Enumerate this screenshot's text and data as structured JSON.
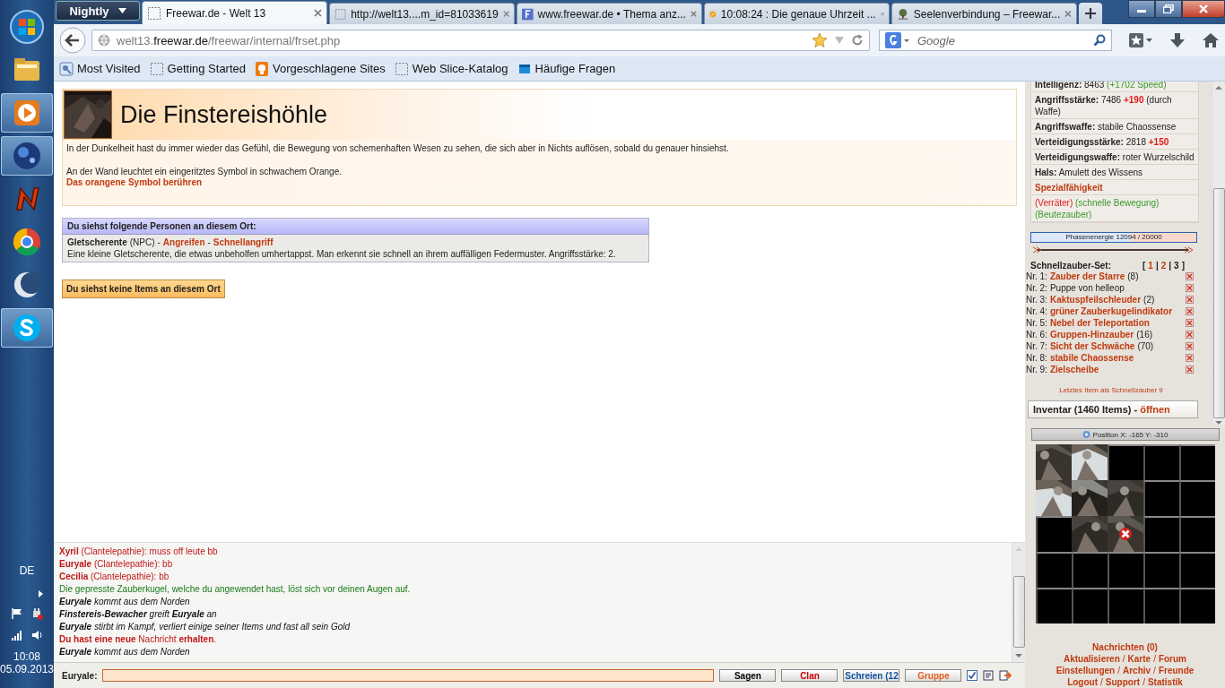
{
  "taskbar": {
    "apps": [
      {
        "kind": "start",
        "selected": false
      },
      {
        "kind": "folder",
        "selected": false
      },
      {
        "kind": "player",
        "selected": true
      },
      {
        "kind": "globe",
        "selected": true
      },
      {
        "kind": "letter",
        "selected": false
      },
      {
        "kind": "chrome",
        "selected": false
      },
      {
        "kind": "moon",
        "selected": false
      },
      {
        "kind": "skype",
        "selected": true
      }
    ],
    "language": "DE",
    "time": "10:08",
    "date": "05.09.2013"
  },
  "browser": {
    "menu_button": "Nightly",
    "tabs": [
      {
        "title": "Freewar.de - Welt 13",
        "selected": true
      },
      {
        "title": "http://welt13....m_id=81033619",
        "selected": false
      },
      {
        "title": "www.freewar.de • Thema anz...",
        "selected": false
      },
      {
        "title": "10:08:24 : Die genaue Uhrzeit ...",
        "selected": false
      },
      {
        "title": "Seelenverbindung – Freewar...",
        "selected": false
      }
    ],
    "url": "welt13.**freewar.de**/freewar/internal/frset.php",
    "search_placeholder": "Google",
    "bookmarks": [
      "Most Visited",
      "Getting Started",
      "Vorgeschlagene Sites",
      "Web Slice-Katalog",
      "Häufige Fragen"
    ]
  },
  "location": {
    "title": "Die Finstereishöhle",
    "description": "In der Dunkelheit hast du immer wieder das Gefühl, die Bewegung von schemenhaften Wesen zu sehen, die sich aber in Nichts auflösen, sobald du genauer hinsiehst.",
    "note": "An der Wand leuchtet ein eingeritztes Symbol in schwachem Orange.",
    "action": "Das orangene Symbol berühren"
  },
  "persons": {
    "header": "Du siehst folgende Personen an diesem Ort:",
    "entries": [
      {
        "name": "Gletscherente",
        "tag": "(NPC)",
        "separators": [
          "-",
          "-"
        ],
        "actions": [
          "Angreifen",
          "Schnellangriff"
        ],
        "description": "Eine kleine Gletscherente, die etwas unbeholfen umhertappst. Man erkennt sie schnell an ihrem auffälligen Federmuster. Angriffsstärke: 2."
      }
    ]
  },
  "items_notice": "Du siehst keine Items an diesem Ort",
  "chat": {
    "messages": [
      {
        "kind": "whisper",
        "text": "**Xyril** (Clantelepathie): muss off leute bb"
      },
      {
        "kind": "whisper",
        "text": "**Euryale** (Clantelepathie): bb"
      },
      {
        "kind": "whisper",
        "text": "**Cecilia** (Clantelepathie): bb"
      },
      {
        "kind": "system",
        "text": "Die gepresste Zauberkugel, welche du angewendet hast, löst sich vor deinen Augen auf."
      },
      {
        "kind": "event",
        "text": "**Euryale** kommt aus dem Norden"
      },
      {
        "kind": "event",
        "text": "**Finstereis-Bewacher** greift **Euryale** an"
      },
      {
        "kind": "event",
        "text": "**Euryale** stirbt im Kampf, verliert einige seiner Items und fast all sein Gold"
      },
      {
        "kind": "alert",
        "text": "**Du hast eine neue** Nachricht **erhalten**."
      },
      {
        "kind": "event",
        "text": "**Euryale** kommt aus dem Norden"
      }
    ],
    "input_label": "Euryale:",
    "buttons": [
      {
        "label": "Sagen",
        "color": "#000000"
      },
      {
        "label": "Clan",
        "color": "#cc0000"
      },
      {
        "label": "Schreien (12",
        "color": "#1050a0"
      },
      {
        "label": "Gruppe",
        "color": "#e06020"
      }
    ],
    "checkbox_checked": true
  },
  "stats": {
    "lines": [
      {
        "parts": [
          {
            "text": "Intelligenz:",
            "kind": "label"
          },
          {
            "text": "8463",
            "kind": "value"
          },
          {
            "text": "(+1702 Speed)",
            "kind": "bonus"
          }
        ]
      },
      {
        "parts": [
          {
            "text": "Angriffsstärke:",
            "kind": "label"
          },
          {
            "text": "7486",
            "kind": "value"
          },
          {
            "text": "+190",
            "kind": "boost"
          },
          {
            "text": "(durch Waffe)",
            "kind": "value"
          }
        ]
      },
      {
        "parts": [
          {
            "text": "Angriffswaffe:",
            "kind": "label"
          },
          {
            "text": "stabile Chaossense",
            "kind": "value"
          }
        ]
      },
      {
        "parts": [
          {
            "text": "Verteidigungsstärke:",
            "kind": "label"
          },
          {
            "text": "2818",
            "kind": "value"
          },
          {
            "text": "+150",
            "kind": "boost"
          }
        ]
      },
      {
        "parts": [
          {
            "text": "Verteidigungswaffe:",
            "kind": "label"
          },
          {
            "text": "roter Wurzelschild",
            "kind": "value"
          }
        ]
      },
      {
        "parts": [
          {
            "text": "Hals:",
            "kind": "label"
          },
          {
            "text": "Amulett des Wissens",
            "kind": "value"
          }
        ]
      },
      {
        "parts": [
          {
            "text": "Spezialfähigkeit",
            "kind": "heading"
          }
        ]
      },
      {
        "parts": [
          {
            "text": "(Verräter)",
            "kind": "malus"
          },
          {
            "text": "(schnelle Bewegung)",
            "kind": "bonus"
          },
          {
            "text": "(Beutezauber)",
            "kind": "bonus"
          }
        ]
      }
    ]
  },
  "phase_energy": {
    "reading": "Phasenenergie 12094 / 20000",
    "level": 0.6047
  },
  "quick_spells": {
    "label": "Schnellzauber-Set:",
    "open_bracket": "[",
    "close_bracket": "]",
    "separators": [
      "|",
      "|"
    ],
    "sets": [
      {
        "label": "1",
        "selected": false
      },
      {
        "label": "2",
        "selected": false
      },
      {
        "label": "3",
        "selected": true
      }
    ],
    "spells": [
      {
        "number": "Nr. 1:",
        "name": "Zauber der Starre",
        "count": "(8)",
        "link": true
      },
      {
        "number": "Nr. 2:",
        "name": "Puppe von helleop",
        "link": false
      },
      {
        "number": "Nr. 3:",
        "name": "Kaktuspfeilschleuder",
        "count": "(2)",
        "link": true
      },
      {
        "number": "Nr. 4:",
        "name": "grüner Zauberkugelindikator",
        "link": true
      },
      {
        "number": "Nr. 5:",
        "name": "Nebel der Teleportation",
        "link": true
      },
      {
        "number": "Nr. 6:",
        "name": "Gruppen-Hinzauber",
        "count": "(16)",
        "link": true
      },
      {
        "number": "Nr. 7:",
        "name": "Sicht der Schwäche",
        "count": "(70)",
        "link": true
      },
      {
        "number": "Nr. 8:",
        "name": "stabile Chaossense",
        "link": true
      },
      {
        "number": "Nr. 9:",
        "name": "Zielscheibe",
        "link": true
      }
    ],
    "last_item": "Letztes Item als Schnellzauber 9"
  },
  "inventory": {
    "label": "Inventar (1460 Items) -",
    "action": "öffnen"
  },
  "map": {
    "position": "Position X: -165 Y: -310",
    "tiles": [
      {
        "kind": "picture",
        "current": false
      },
      {
        "kind": "picture",
        "current": false
      },
      {
        "kind": "empty",
        "current": false
      },
      {
        "kind": "empty",
        "current": false
      },
      {
        "kind": "empty",
        "current": false
      },
      {
        "kind": "picture",
        "current": false
      },
      {
        "kind": "picture",
        "current": false
      },
      {
        "kind": "picture",
        "current": false
      },
      {
        "kind": "empty",
        "current": false
      },
      {
        "kind": "empty",
        "current": false
      },
      {
        "kind": "empty",
        "current": false
      },
      {
        "kind": "picture",
        "current": false
      },
      {
        "kind": "picture",
        "current": true
      },
      {
        "kind": "empty",
        "current": false
      },
      {
        "kind": "empty",
        "current": false
      },
      {
        "kind": "empty",
        "current": false
      },
      {
        "kind": "empty",
        "current": false
      },
      {
        "kind": "empty",
        "current": false
      },
      {
        "kind": "empty",
        "current": false
      },
      {
        "kind": "empty",
        "current": false
      },
      {
        "kind": "empty",
        "current": false
      },
      {
        "kind": "empty",
        "current": false
      },
      {
        "kind": "empty",
        "current": false
      },
      {
        "kind": "empty",
        "current": false
      },
      {
        "kind": "empty",
        "current": false
      }
    ]
  },
  "footer_links": [
    {
      "links": [
        "Nachrichten (0)"
      ]
    },
    {
      "links": [
        "Aktualisieren",
        "Karte",
        "Forum"
      ],
      "separators": [
        "/",
        "/"
      ]
    },
    {
      "links": [
        "Einstellungen",
        "Archiv",
        "Freunde"
      ],
      "separators": [
        "/",
        "/"
      ]
    },
    {
      "links": [
        "Logout",
        "Support",
        "Statistik"
      ],
      "separators": [
        "/",
        "/"
      ]
    }
  ]
}
